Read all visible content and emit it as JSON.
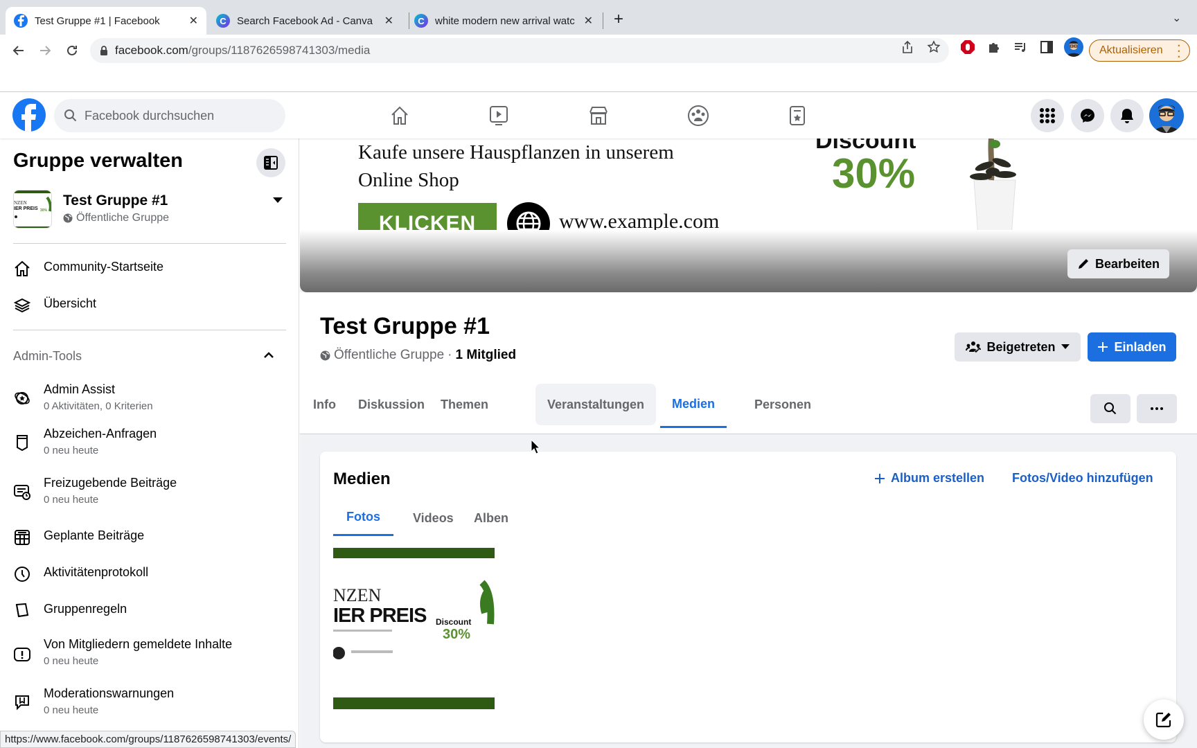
{
  "browser": {
    "tabs": [
      {
        "title": "Test Gruppe #1 | Facebook",
        "icon": "facebook-icon",
        "active": true
      },
      {
        "title": "Search Facebook Ad - Canva",
        "icon": "canva-icon",
        "active": false
      },
      {
        "title": "white modern new arrival watc",
        "icon": "canva-icon",
        "active": false
      }
    ],
    "new_tab_label": "+",
    "url_domain": "facebook.com",
    "url_path": "/groups/1187626598741303/media",
    "update_button": "Aktualisieren",
    "status_url": "https://www.facebook.com/groups/1187626598741303/events/"
  },
  "fb_header": {
    "search_placeholder": "Facebook durchsuchen",
    "nav_icons": [
      "home-icon",
      "watch-icon",
      "marketplace-icon",
      "groups-icon",
      "gaming-icon"
    ],
    "right_icons": [
      "menu-grid-icon",
      "messenger-icon",
      "notifications-icon",
      "profile-avatar"
    ]
  },
  "sidebar": {
    "title": "Gruppe verwalten",
    "group_name": "Test Gruppe #1",
    "group_type": "Öffentliche Gruppe",
    "nav": [
      {
        "label": "Community-Startseite",
        "icon": "home-icon"
      },
      {
        "label": "Übersicht",
        "icon": "layers-icon"
      }
    ],
    "section_title": "Admin-Tools",
    "admin_items": [
      {
        "label": "Admin Assist",
        "sub": "0 Aktivitäten, 0 Kriterien",
        "icon": "admin-assist-icon"
      },
      {
        "label": "Abzeichen-Anfragen",
        "sub": "0 neu heute",
        "icon": "badge-icon"
      },
      {
        "label": "Freizugebende Beiträge",
        "sub": "0 neu heute",
        "icon": "pending-posts-icon"
      },
      {
        "label": "Geplante Beiträge",
        "sub": "",
        "icon": "calendar-icon"
      },
      {
        "label": "Aktivitätenprotokoll",
        "sub": "",
        "icon": "clock-icon"
      },
      {
        "label": "Gruppenregeln",
        "sub": "",
        "icon": "rules-book-icon"
      },
      {
        "label": "Von Mitgliedern gemeldete Inhalte",
        "sub": "0 neu heute",
        "icon": "report-icon"
      },
      {
        "label": "Moderationswarnungen",
        "sub": "0 neu heute",
        "icon": "moderation-alert-icon"
      }
    ]
  },
  "cover": {
    "line1": "Kaufe unsere Hauspflanzen in unserem",
    "line2": "Online Shop",
    "cta": "KLICKEN",
    "website": "www.example.com",
    "discount_label": "Discount",
    "discount_value": "30%",
    "edit_button": "Bearbeiten"
  },
  "group": {
    "title": "Test Gruppe #1",
    "privacy": "Öffentliche Gruppe",
    "members": "1 Mitglied",
    "joined_button": "Beigetreten",
    "invite_button": "Einladen",
    "tabs": [
      "Info",
      "Diskussion",
      "Themen",
      "Veranstaltungen",
      "Medien",
      "Personen"
    ],
    "active_tab": "Medien",
    "hovered_tab": "Veranstaltungen"
  },
  "media": {
    "title": "Medien",
    "create_album": "Album erstellen",
    "add_media": "Fotos/Video hinzufügen",
    "tabs": [
      "Fotos",
      "Videos",
      "Alben"
    ],
    "active_tab": "Fotos",
    "photo": {
      "line1": "NZEN",
      "line2": "IER PREIS",
      "discount_label": "Discount",
      "discount_value": "30%"
    }
  },
  "colors": {
    "fb_blue": "#1877f2",
    "accent_blue": "#1b6fe0",
    "plant_green": "#5b9230",
    "dark_green": "#2f5a14"
  }
}
